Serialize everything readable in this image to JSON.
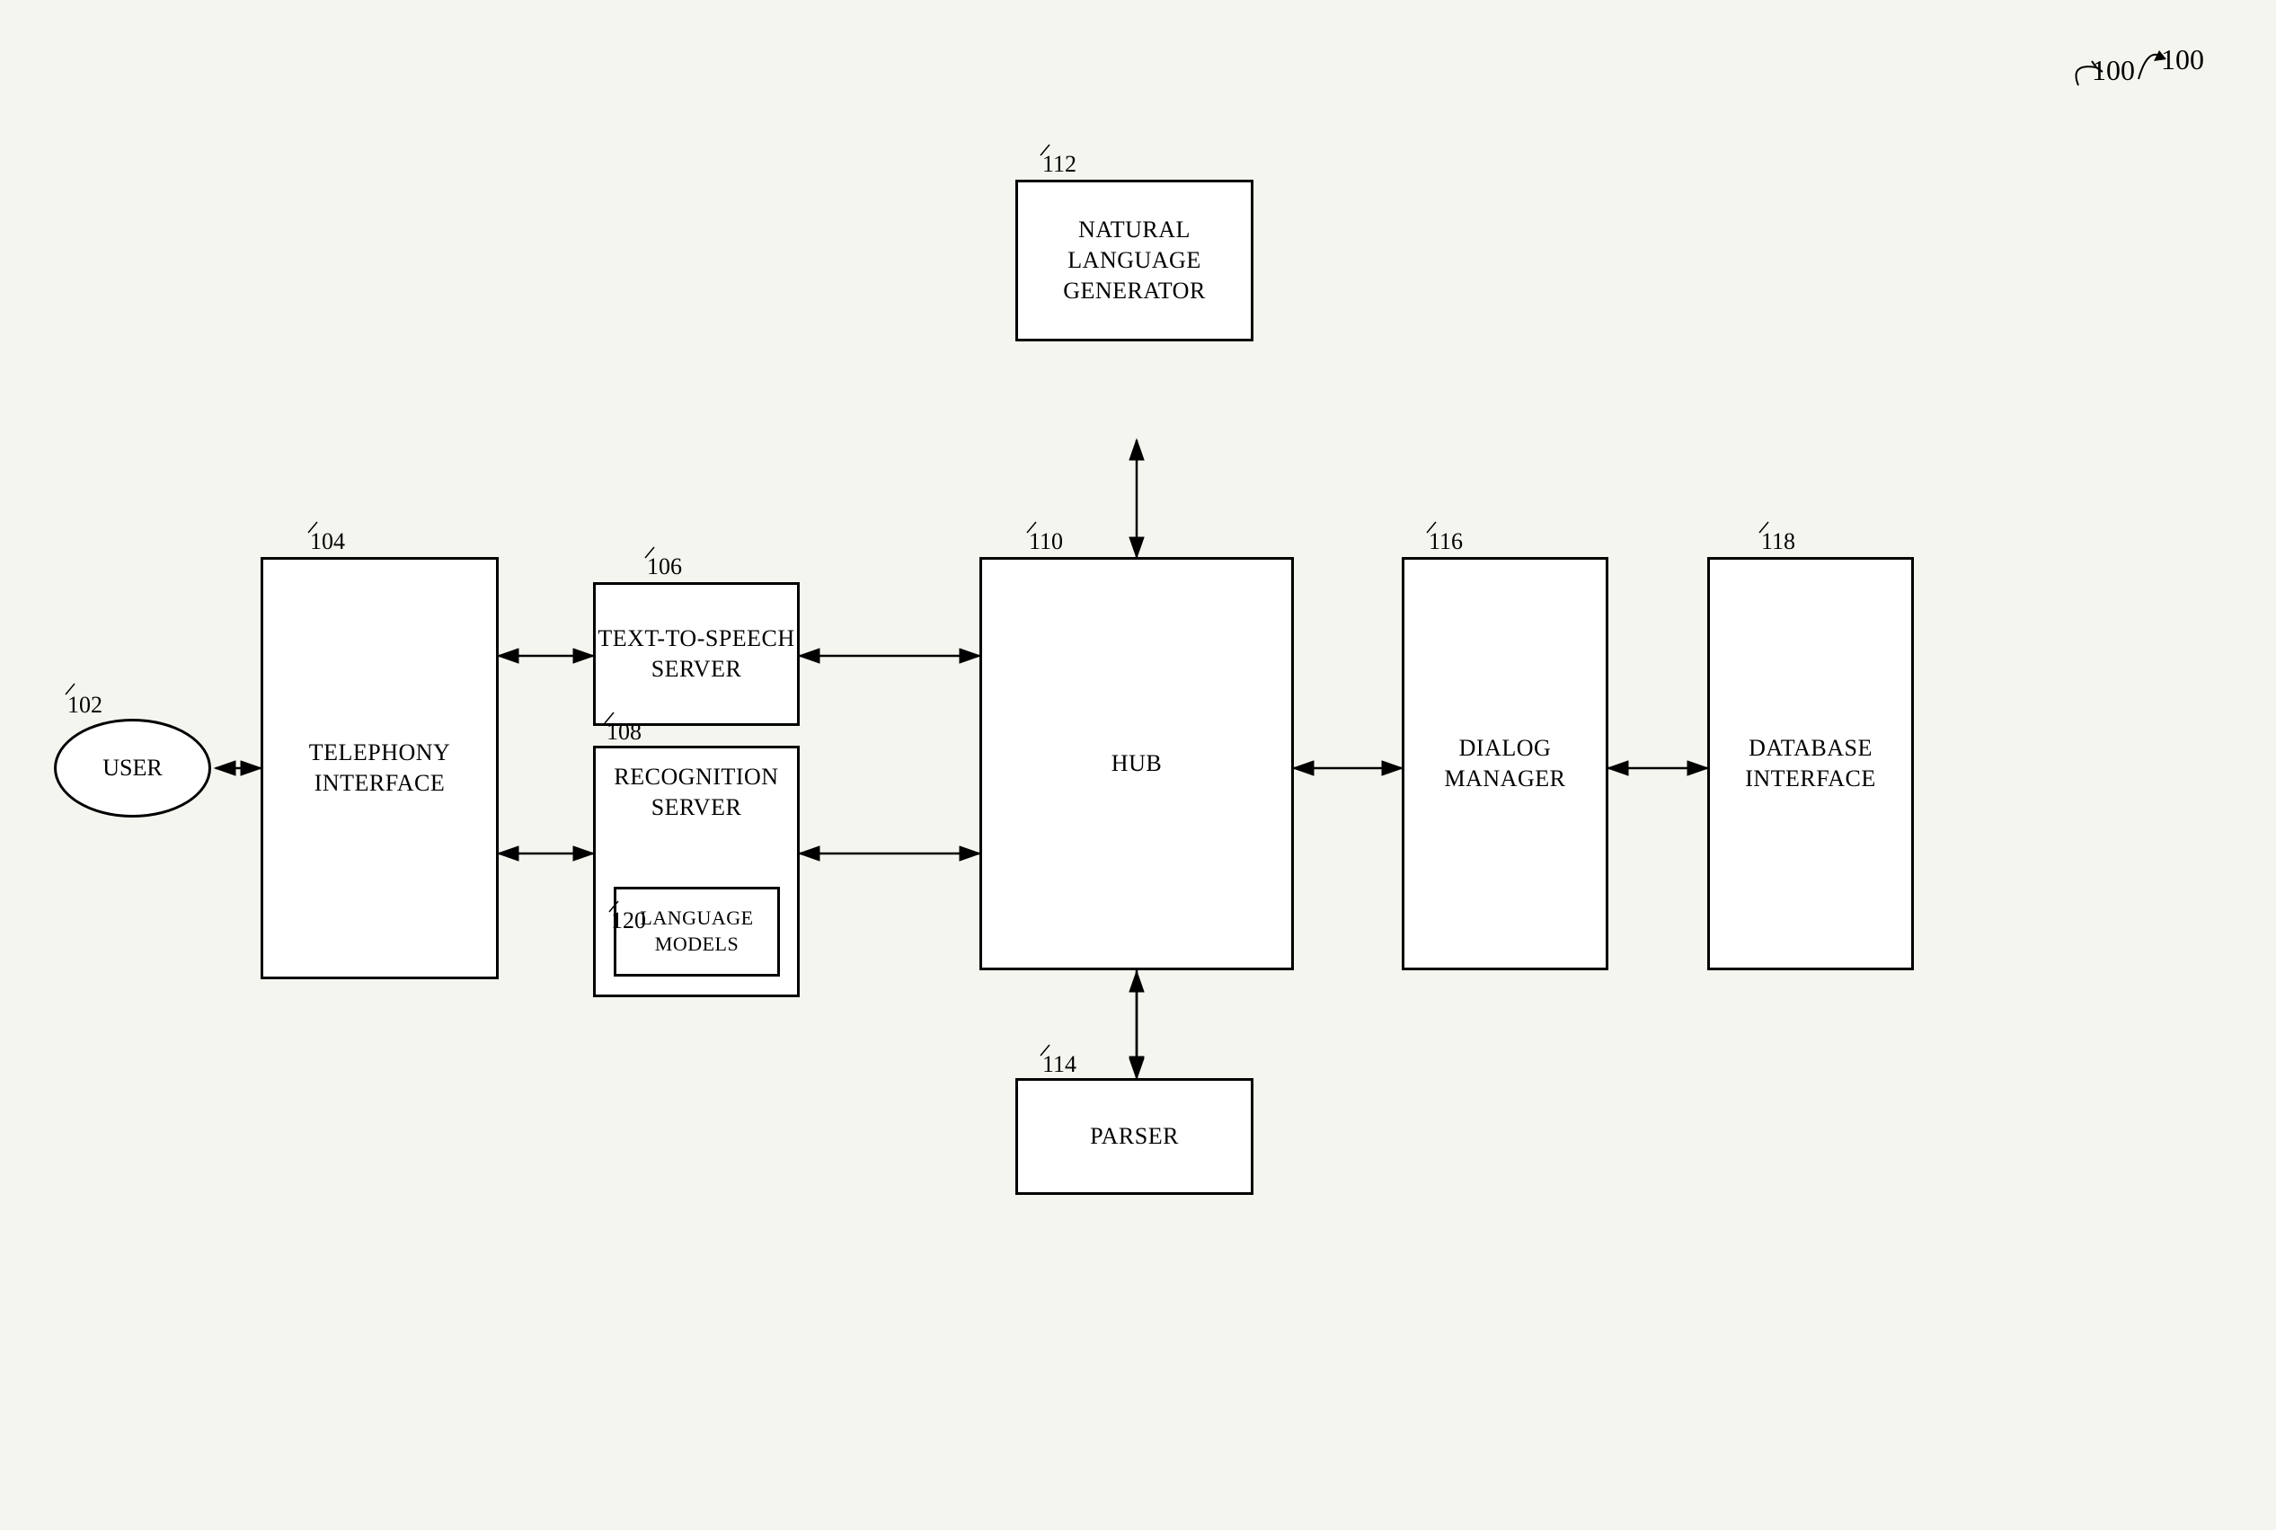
{
  "diagram": {
    "title": "100",
    "nodes": {
      "user": {
        "label": "USER",
        "ref": "102"
      },
      "telephony": {
        "label": "TELEPHONY\nINTERFACE",
        "ref": "104"
      },
      "tts": {
        "label": "TEXT-TO-SPEECH\nSERVER",
        "ref": "106"
      },
      "recognition": {
        "label": "RECOGNITION\nSERVER",
        "ref": "108"
      },
      "language_models": {
        "label": "LANGUAGE\nMODELS",
        "ref": "120"
      },
      "hub": {
        "label": "HUB",
        "ref": "110"
      },
      "nlg": {
        "label": "NATURAL\nLANGUAGE\nGENERATOR",
        "ref": "112"
      },
      "parser": {
        "label": "PARSER",
        "ref": "114"
      },
      "dialog": {
        "label": "DIALOG\nMANAGER",
        "ref": "116"
      },
      "database": {
        "label": "DATABASE\nINTERFACE",
        "ref": "118"
      }
    }
  }
}
